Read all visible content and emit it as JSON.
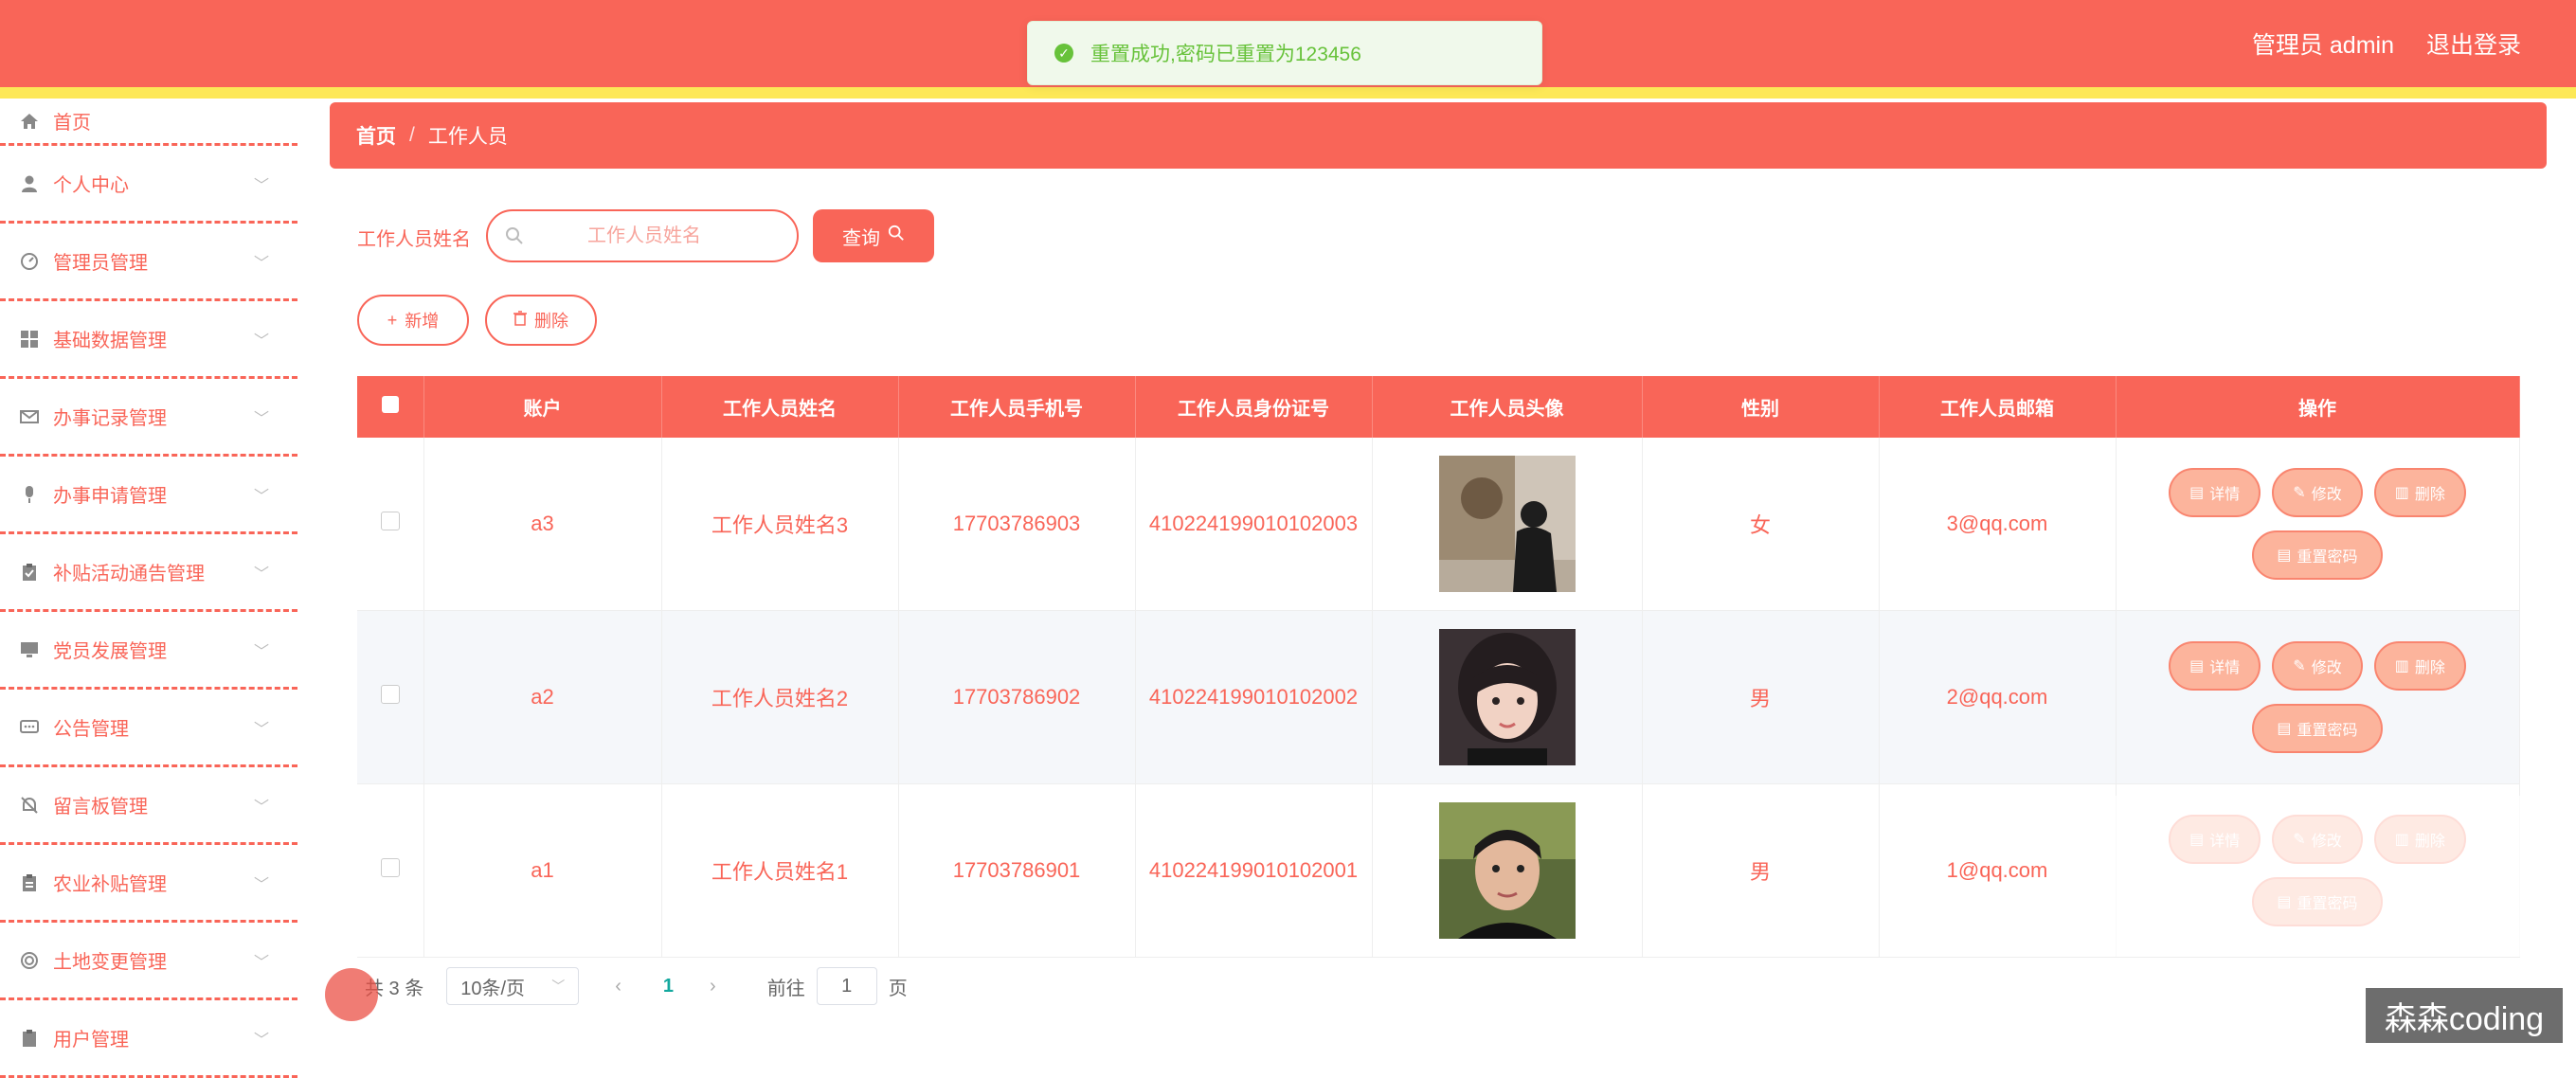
{
  "header": {
    "admin_label": "管理员 admin",
    "logout": "退出登录"
  },
  "toast": {
    "message": "重置成功,密码已重置为123456"
  },
  "sidebar": {
    "items": [
      {
        "label": "首页",
        "icon": "home-icon"
      },
      {
        "label": "个人中心",
        "icon": "user-icon"
      },
      {
        "label": "管理员管理",
        "icon": "gauge-icon"
      },
      {
        "label": "基础数据管理",
        "icon": "grid-icon"
      },
      {
        "label": "办事记录管理",
        "icon": "mail-icon"
      },
      {
        "label": "办事申请管理",
        "icon": "mic-icon"
      },
      {
        "label": "补贴活动通告管理",
        "icon": "clipboard-check-icon"
      },
      {
        "label": "党员发展管理",
        "icon": "monitor-icon"
      },
      {
        "label": "公告管理",
        "icon": "chat-icon"
      },
      {
        "label": "留言板管理",
        "icon": "bell-off-icon"
      },
      {
        "label": "农业补贴管理",
        "icon": "clipboard-icon"
      },
      {
        "label": "土地变更管理",
        "icon": "target-icon"
      },
      {
        "label": "用户管理",
        "icon": "clipboard-icon"
      }
    ]
  },
  "breadcrumb": {
    "home": "首页",
    "sep": "/",
    "current": "工作人员"
  },
  "search": {
    "label": "工作人员姓名",
    "placeholder": "工作人员姓名",
    "button": "查询"
  },
  "actions": {
    "add": "新增",
    "delete": "删除"
  },
  "table": {
    "headers": [
      "账户",
      "工作人员姓名",
      "工作人员手机号",
      "工作人员身份证号",
      "工作人员头像",
      "性别",
      "工作人员邮箱",
      "操作"
    ],
    "rows": [
      {
        "account": "a3",
        "name": "工作人员姓名3",
        "phone": "17703786903",
        "idcard": "410224199010102003",
        "gender": "女",
        "email": "3@qq.com"
      },
      {
        "account": "a2",
        "name": "工作人员姓名2",
        "phone": "17703786902",
        "idcard": "410224199010102002",
        "gender": "男",
        "email": "2@qq.com"
      },
      {
        "account": "a1",
        "name": "工作人员姓名1",
        "phone": "17703786901",
        "idcard": "410224199010102001",
        "gender": "男",
        "email": "1@qq.com"
      }
    ],
    "op_labels": {
      "detail": "详情",
      "edit": "修改",
      "delete": "删除",
      "reset": "重置密码"
    }
  },
  "pagination": {
    "total": "共 3 条",
    "page_size": "10条/页",
    "current": "1",
    "goto_label": "前往",
    "goto_value": "1",
    "page_unit": "页"
  },
  "watermark": "森森coding",
  "colors": {
    "primary": "#f96558",
    "accent_stripe": "#fde857",
    "success": "#67c23a",
    "button_fill": "#fcb49c"
  }
}
